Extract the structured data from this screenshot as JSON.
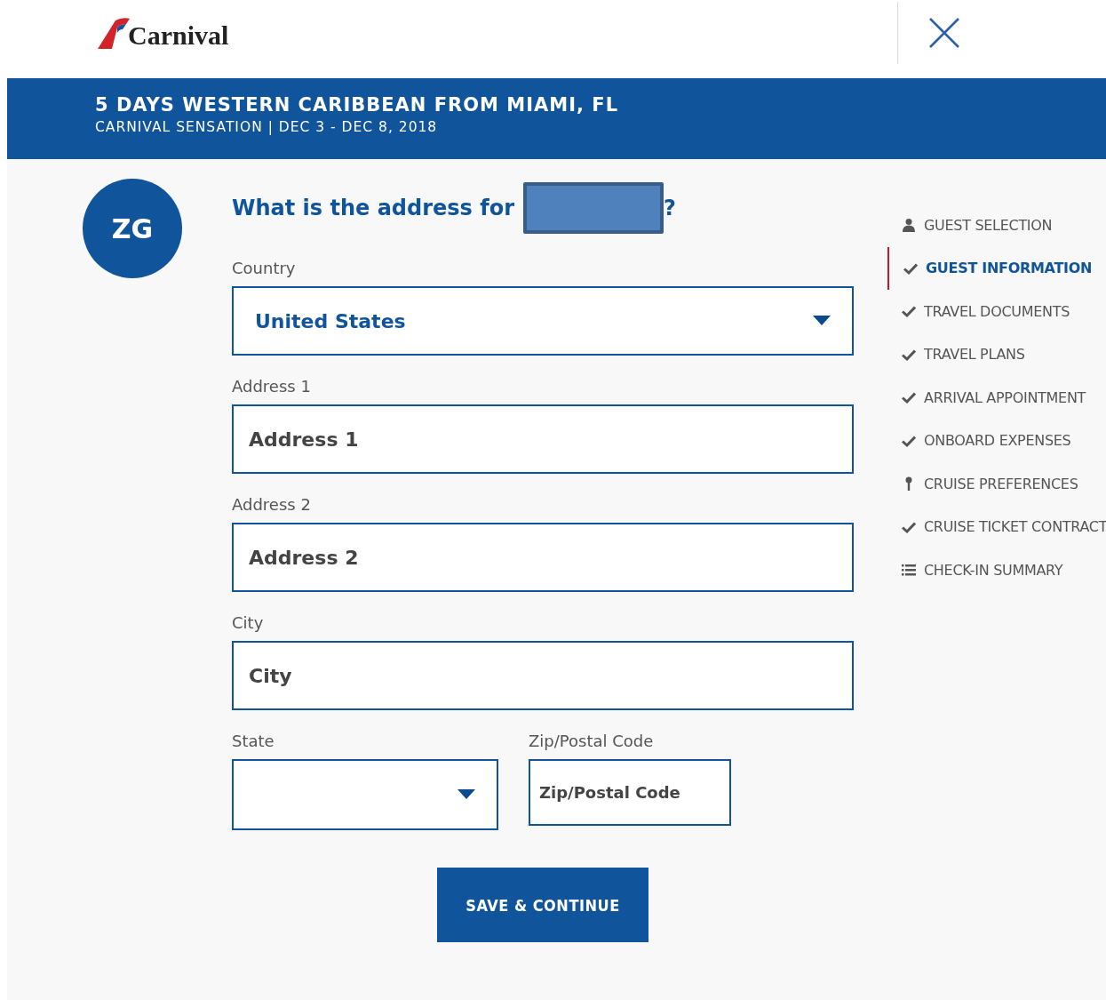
{
  "header": {
    "logo_text": "Carnival"
  },
  "banner": {
    "title": "5 DAYS WESTERN CARIBBEAN FROM MIAMI, FL",
    "subtitle": "CARNIVAL SENSATION | DEC 3 - DEC 8, 2018"
  },
  "guest": {
    "initials": "ZG"
  },
  "question": {
    "text": "What is the address for",
    "end": "?"
  },
  "fields": [
    {
      "label": "Country",
      "kind": "select",
      "value": "United States"
    },
    {
      "label": "Address 1",
      "kind": "text",
      "placeholder": "Address 1"
    },
    {
      "label": "Address 2",
      "kind": "text",
      "placeholder": "Address 2"
    },
    {
      "label": "City",
      "kind": "text",
      "placeholder": "City"
    }
  ],
  "row_fields": [
    {
      "label": "State",
      "kind": "select"
    },
    {
      "label": "Zip/Postal Code",
      "kind": "text",
      "placeholder": "Zip/Postal Code"
    }
  ],
  "submit": "SAVE & CONTINUE",
  "steps": [
    {
      "label": "GUEST SELECTION",
      "kind": "person",
      "selected": false
    },
    {
      "label": "GUEST INFORMATION",
      "kind": "check",
      "selected": true
    },
    {
      "label": "TRAVEL DOCUMENTS",
      "kind": "check",
      "selected": false
    },
    {
      "label": "TRAVEL PLANS",
      "kind": "check",
      "selected": false
    },
    {
      "label": "ARRIVAL APPOINTMENT",
      "kind": "check",
      "selected": false
    },
    {
      "label": "ONBOARD EXPENSES",
      "kind": "check",
      "selected": false
    },
    {
      "label": "CRUISE PREFERENCES",
      "kind": "pin",
      "selected": false
    },
    {
      "label": "CRUISE TICKET CONTRACT",
      "kind": "check",
      "selected": false
    },
    {
      "label": "CHECK-IN SUMMARY",
      "kind": "list",
      "selected": false
    }
  ]
}
